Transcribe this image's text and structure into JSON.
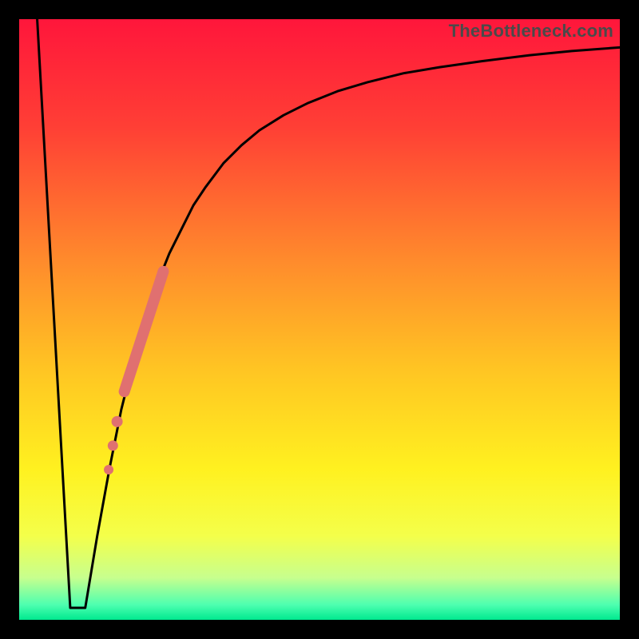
{
  "watermark": "TheBottleneck.com",
  "chart_data": {
    "type": "line",
    "title": "",
    "xlabel": "",
    "ylabel": "",
    "xlim": [
      0,
      100
    ],
    "ylim": [
      0,
      100
    ],
    "grid": false,
    "background_gradient": {
      "stops": [
        {
          "offset": 0.0,
          "color": "#ff163b"
        },
        {
          "offset": 0.18,
          "color": "#ff3f35"
        },
        {
          "offset": 0.4,
          "color": "#ff8a2c"
        },
        {
          "offset": 0.58,
          "color": "#ffc423"
        },
        {
          "offset": 0.75,
          "color": "#fff120"
        },
        {
          "offset": 0.86,
          "color": "#f4ff4a"
        },
        {
          "offset": 0.93,
          "color": "#c7ff8e"
        },
        {
          "offset": 0.975,
          "color": "#4dffb0"
        },
        {
          "offset": 1.0,
          "color": "#00e98f"
        }
      ]
    },
    "series": [
      {
        "name": "left-descent",
        "type": "line",
        "x": [
          3.0,
          8.5
        ],
        "y": [
          100,
          2
        ]
      },
      {
        "name": "valley-floor",
        "type": "line",
        "x": [
          8.5,
          11.0
        ],
        "y": [
          2,
          2
        ]
      },
      {
        "name": "main-curve",
        "type": "line",
        "x": [
          11.0,
          13,
          15,
          17,
          19,
          21,
          23,
          25,
          27,
          29,
          31,
          34,
          37,
          40,
          44,
          48,
          53,
          58,
          64,
          70,
          77,
          85,
          92,
          100
        ],
        "y": [
          2,
          14,
          25,
          35,
          43,
          50,
          56,
          61,
          65,
          69,
          72,
          76,
          79,
          81.5,
          84,
          86,
          88,
          89.5,
          91,
          92,
          93,
          94,
          94.7,
          95.3
        ]
      }
    ],
    "highlight": {
      "name": "highlight-band",
      "color": "#e07070",
      "segment": {
        "x": [
          17.5,
          24.0
        ],
        "y": [
          38,
          58
        ]
      },
      "dots": [
        {
          "x": 16.3,
          "y": 33
        },
        {
          "x": 15.6,
          "y": 29
        },
        {
          "x": 14.9,
          "y": 25
        }
      ]
    }
  }
}
